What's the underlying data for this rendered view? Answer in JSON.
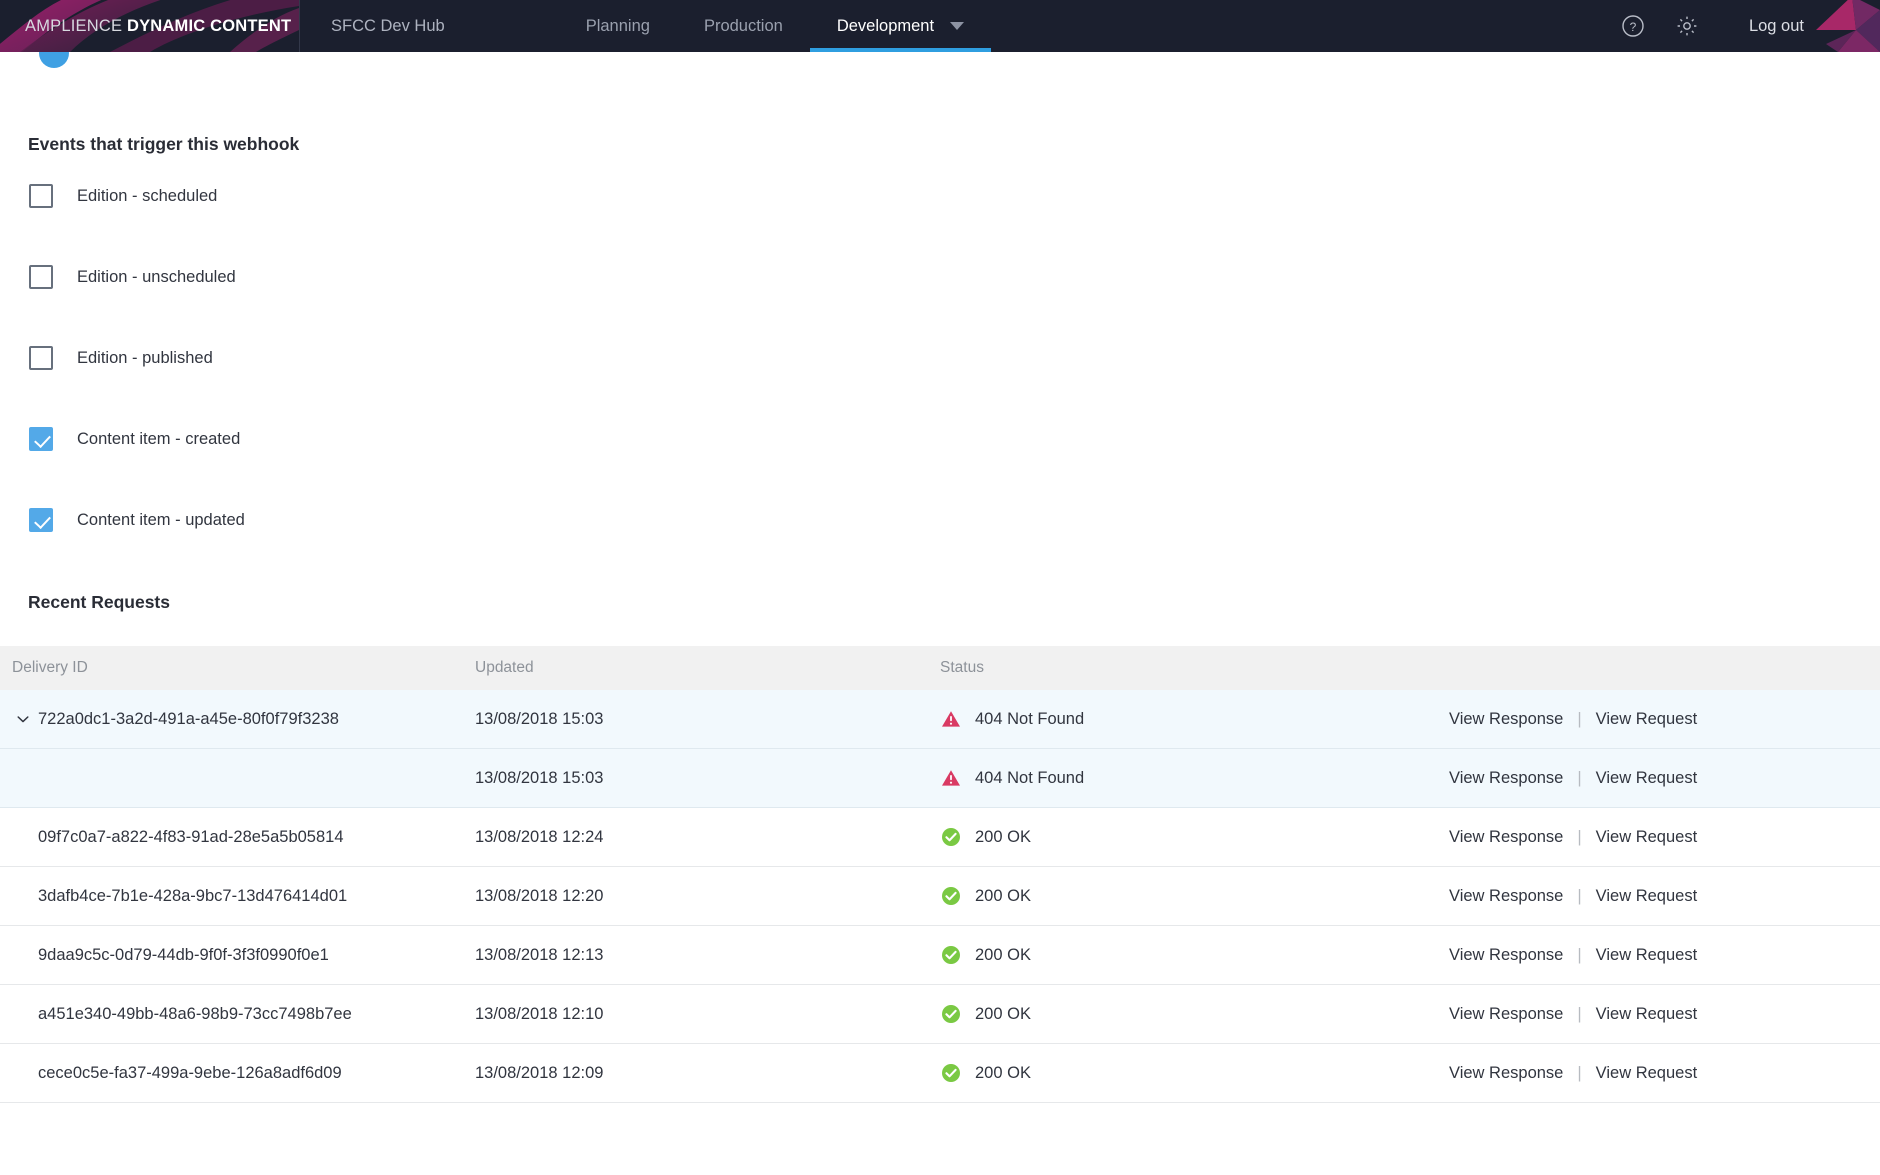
{
  "header": {
    "brand_prefix": "AMPLIENCE ",
    "brand_bold": "DYNAMIC CONTENT",
    "hub_name": "SFCC Dev Hub",
    "tabs": [
      {
        "label": "Planning",
        "active": false
      },
      {
        "label": "Production",
        "active": false
      },
      {
        "label": "Development",
        "active": true
      }
    ],
    "help_icon": "help-circle-icon",
    "settings_icon": "gear-icon",
    "logout_label": "Log out",
    "accent_color": "#2f9ee0",
    "background_color": "#1b1f2e"
  },
  "events": {
    "title": "Events that trigger this webhook",
    "items": [
      {
        "label": "Edition - scheduled",
        "checked": false
      },
      {
        "label": "Edition - unscheduled",
        "checked": false
      },
      {
        "label": "Edition - published",
        "checked": false
      },
      {
        "label": "Content item - created",
        "checked": true
      },
      {
        "label": "Content item - updated",
        "checked": true
      }
    ],
    "checked_color": "#53a9e8"
  },
  "recent_requests": {
    "title": "Recent Requests",
    "columns": [
      "Delivery ID",
      "Updated",
      "Status"
    ],
    "actions": {
      "view_response": "View Response",
      "separator": "|",
      "view_request": "View Request"
    },
    "status_colors": {
      "error": "#d93a63",
      "success": "#7ac943"
    },
    "rows": [
      {
        "delivery_id": "722a0dc1-3a2d-491a-a45e-80f0f79f3238",
        "updated": "13/08/2018 15:03",
        "status": "404 Not Found",
        "status_type": "error",
        "expandable": true,
        "expanded": true,
        "highlight": true
      },
      {
        "delivery_id": "",
        "updated": "13/08/2018 15:03",
        "status": "404 Not Found",
        "status_type": "error",
        "expandable": false,
        "expanded": false,
        "highlight": true
      },
      {
        "delivery_id": "09f7c0a7-a822-4f83-91ad-28e5a5b05814",
        "updated": "13/08/2018 12:24",
        "status": "200 OK",
        "status_type": "success",
        "expandable": false,
        "expanded": false,
        "highlight": false
      },
      {
        "delivery_id": "3dafb4ce-7b1e-428a-9bc7-13d476414d01",
        "updated": "13/08/2018 12:20",
        "status": "200 OK",
        "status_type": "success",
        "expandable": false,
        "expanded": false,
        "highlight": false
      },
      {
        "delivery_id": "9daa9c5c-0d79-44db-9f0f-3f3f0990f0e1",
        "updated": "13/08/2018 12:13",
        "status": "200 OK",
        "status_type": "success",
        "expandable": false,
        "expanded": false,
        "highlight": false
      },
      {
        "delivery_id": "a451e340-49bb-48a6-98b9-73cc7498b7ee",
        "updated": "13/08/2018 12:10",
        "status": "200 OK",
        "status_type": "success",
        "expandable": false,
        "expanded": false,
        "highlight": false
      },
      {
        "delivery_id": "cece0c5e-fa37-499a-9ebe-126a8adf6d09",
        "updated": "13/08/2018 12:09",
        "status": "200 OK",
        "status_type": "success",
        "expandable": false,
        "expanded": false,
        "highlight": false
      }
    ]
  }
}
